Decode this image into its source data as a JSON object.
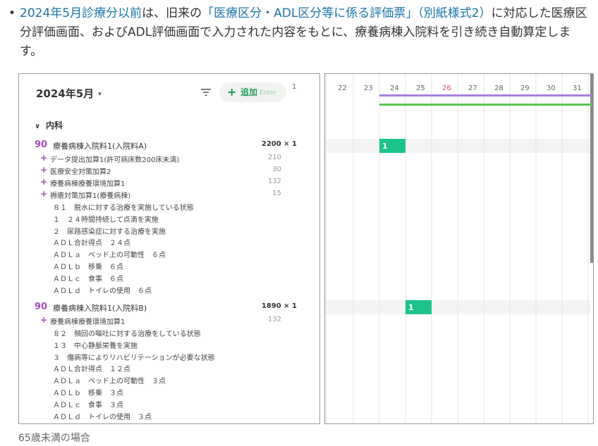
{
  "intro": {
    "bullet": "•",
    "link1": "2024年5月診療分以前",
    "text1": "は、旧来の",
    "link2": "「医療区分・ADL区分等に係る評価票」（別紙様式2）",
    "text2": "に対応した医療区分評価画面、およびADL評価画面で入力された内容をもとに、療養病棟入院料を引き続き自動算定します。"
  },
  "left_panel": {
    "title": "2024年5月",
    "caret": "▾",
    "add_plus": "+",
    "add_label": "追加",
    "add_kbd": "Enter",
    "department": "内科",
    "dept_chevron": "∨",
    "group_a": {
      "score": "90",
      "name": "療養病棟入院料1(入院料A)",
      "qty": "2200 × 1",
      "additions": [
        {
          "name": "データ提出加算1(許可病床数200床未満)",
          "points": "210"
        },
        {
          "name": "医療安全対策加算2",
          "points": "30"
        },
        {
          "name": "療養病棟療養環境加算1",
          "points": "132"
        },
        {
          "name": "褥瘡対策加算1(療養病棟)",
          "points": "15"
        }
      ],
      "notes": [
        "８１　脱水に対する治療を実施している状態",
        "１　２４時間持続して点滴を実施",
        "２　尿路感染症に対する治療を実施",
        "ＡＤＬ合計得点　２４点",
        "ＡＤＬａ　ベッド上の可動性　６点",
        "ＡＤＬｂ　移乗　６点",
        "ＡＤＬｃ　食事　６点",
        "ＡＤＬｄ　トイレの使用　６点"
      ]
    },
    "group_b": {
      "score": "90",
      "name": "療養病棟入院料1(入院料B)",
      "qty": "1890 × 1",
      "additions": [
        {
          "name": "療養病棟療養環境加算1",
          "points": "132"
        }
      ],
      "notes": [
        "８２　頻回の嘔吐に対する治療をしている状態",
        "１３　中心静脈栄養を実施",
        "３　傷病等によりリハビリテーションが必要な状態",
        "ＡＤＬ合計得点　１２点",
        "ＡＤＬａ　ベッド上の可動性　３点",
        "ＡＤＬｂ　移乗　３点",
        "ＡＤＬｃ　食事　３点",
        "ＡＤＬｄ　トイレの使用　３点"
      ]
    }
  },
  "chart_data": {
    "type": "table",
    "left_day_label": "1",
    "days": [
      "22",
      "23",
      "24",
      "25",
      "26",
      "27",
      "28",
      "29",
      "30",
      "31"
    ],
    "highlight_day": "26",
    "bars": [
      {
        "name": "purple-range",
        "start_day": "23",
        "end_day": "31",
        "color": "#a77ee0"
      },
      {
        "name": "green-range",
        "start_day": "23",
        "end_day": "31",
        "color": "#5cc25a"
      }
    ],
    "entries": [
      {
        "row": "group_a",
        "day": "23",
        "count": "1"
      },
      {
        "row": "group_b",
        "day": "24",
        "count": "1"
      }
    ]
  },
  "colors": {
    "accent_purple": "#a54bc4",
    "accent_green": "#1f9c56",
    "cell_green": "#1cc48b",
    "link_blue": "#1a73a8",
    "red_day": "#d9534f"
  },
  "caption": "65歳未満の場合"
}
